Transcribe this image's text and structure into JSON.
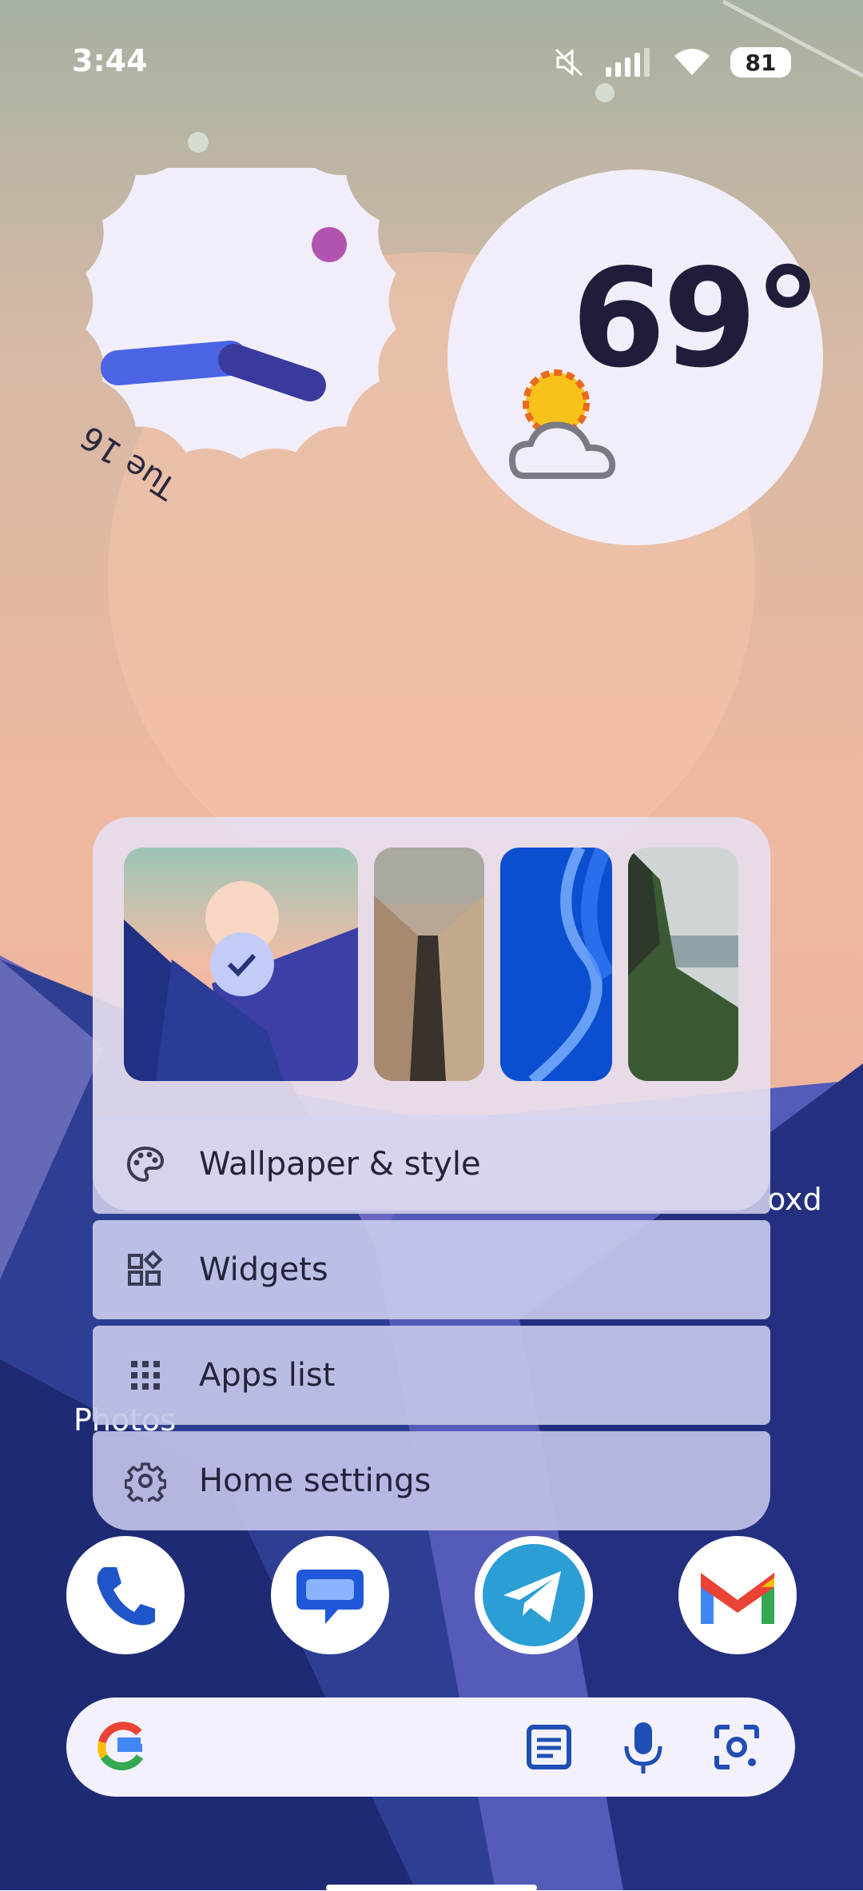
{
  "status_bar": {
    "time": "3:44",
    "battery": "81"
  },
  "clock_widget": {
    "date": "Tue 16"
  },
  "weather_widget": {
    "temperature": "69°"
  },
  "wallpaper_picker": {
    "items": [
      {
        "name": "Mountain sunset",
        "selected": true
      },
      {
        "name": "City street"
      },
      {
        "name": "Blue abstract"
      },
      {
        "name": "Coastal cliffs"
      }
    ]
  },
  "menu": {
    "wallpaper_style": "Wallpaper & style",
    "widgets": "Widgets",
    "apps_list": "Apps list",
    "home_settings": "Home settings"
  },
  "peek_labels": {
    "left": "Photos",
    "right": "oxd"
  },
  "dock": {
    "apps": [
      "Phone",
      "Messages",
      "Telegram",
      "Gmail"
    ]
  },
  "colors": {
    "accent_blue": "#3a56d6",
    "menu_bg": "#e6deee",
    "text_dark": "#25233a"
  }
}
